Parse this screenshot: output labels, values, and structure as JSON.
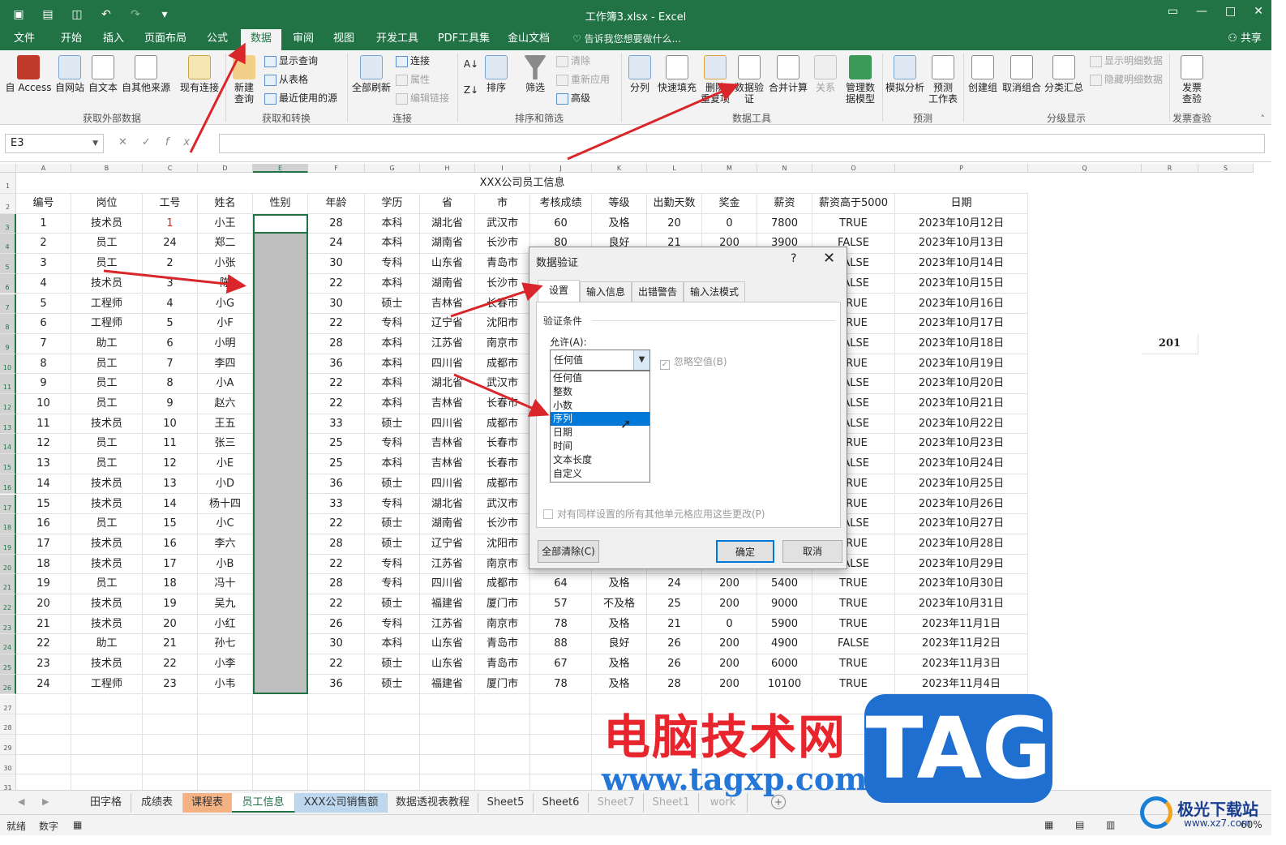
{
  "window": {
    "title": "工作簿3.xlsx - Excel",
    "share_label": "共享",
    "tell_me": "告诉我您想要做什么..."
  },
  "ribbon_tabs": [
    "文件",
    "开始",
    "插入",
    "页面布局",
    "公式",
    "数据",
    "审阅",
    "视图",
    "开发工具",
    "PDF工具集",
    "金山文档"
  ],
  "active_tab": "数据",
  "ribbon": {
    "get_external": {
      "label": "获取外部数据",
      "buttons": [
        "自 Access",
        "自网站",
        "自文本",
        "自其他来源",
        "现有连接"
      ]
    },
    "get_transform": {
      "label": "获取和转换",
      "new_query": "新建\n查询",
      "small": [
        "显示查询",
        "从表格",
        "最近使用的源"
      ]
    },
    "connections": {
      "label": "连接",
      "refresh_all": "全部刷新",
      "small": [
        "连接",
        "属性",
        "编辑链接"
      ]
    },
    "sort_filter": {
      "label": "排序和筛选",
      "sort": "排序",
      "filter": "筛选",
      "small": [
        "清除",
        "重新应用",
        "高级"
      ]
    },
    "data_tools": {
      "label": "数据工具",
      "buttons": [
        "分列",
        "快速填充",
        "删除\n重复项",
        "数据验\n证",
        "合并计算",
        "关系",
        "管理数\n据模型"
      ]
    },
    "forecast": {
      "label": "预测",
      "buttons": [
        "模拟分析",
        "预测\n工作表"
      ]
    },
    "outline": {
      "label": "分级显示",
      "buttons": [
        "创建组",
        "取消组合",
        "分类汇总"
      ],
      "small": [
        "显示明细数据",
        "隐藏明细数据"
      ]
    },
    "invoice": {
      "label": "发票查验",
      "button": "发票\n查验"
    }
  },
  "formula_bar": {
    "name_box": "E3",
    "formula": "",
    "fx": "fx"
  },
  "sheet": {
    "columns": [
      "A",
      "B",
      "C",
      "D",
      "E",
      "F",
      "G",
      "H",
      "I",
      "J",
      "K",
      "L",
      "M",
      "N",
      "O",
      "P",
      "Q",
      "R",
      "S"
    ],
    "title": "XXX公司员工信息",
    "headers": [
      "编号",
      "岗位",
      "工号",
      "姓名",
      "性别",
      "年龄",
      "学历",
      "省",
      "市",
      "考核成绩",
      "等级",
      "出勤天数",
      "奖金",
      "薪资",
      "薪资高于5000",
      "日期"
    ],
    "rows": [
      [
        "1",
        "技术员",
        "1",
        "小王",
        "",
        "28",
        "本科",
        "湖北省",
        "武汉市",
        "60",
        "及格",
        "20",
        "0",
        "7800",
        "TRUE",
        "2023年10月12日"
      ],
      [
        "2",
        "员工",
        "24",
        "郑二",
        "",
        "24",
        "本科",
        "湖南省",
        "长沙市",
        "80",
        "良好",
        "21",
        "200",
        "3900",
        "FALSE",
        "2023年10月13日"
      ],
      [
        "3",
        "员工",
        "2",
        "小张",
        "",
        "30",
        "专科",
        "山东省",
        "青岛市",
        "",
        "",
        "",
        "",
        "",
        "FALSE",
        "2023年10月14日"
      ],
      [
        "4",
        "技术员",
        "3",
        "陈",
        "",
        "22",
        "本科",
        "湖南省",
        "长沙市",
        "",
        "",
        "",
        "",
        "",
        "FALSE",
        "2023年10月15日"
      ],
      [
        "5",
        "工程师",
        "4",
        "小G",
        "",
        "30",
        "硕士",
        "吉林省",
        "长春市",
        "",
        "",
        "",
        "",
        "",
        "TRUE",
        "2023年10月16日"
      ],
      [
        "6",
        "工程师",
        "5",
        "小F",
        "",
        "22",
        "专科",
        "辽宁省",
        "沈阳市",
        "",
        "",
        "",
        "",
        "",
        "TRUE",
        "2023年10月17日"
      ],
      [
        "7",
        "助工",
        "6",
        "小明",
        "",
        "28",
        "本科",
        "江苏省",
        "南京市",
        "",
        "",
        "",
        "",
        "",
        "FALSE",
        "2023年10月18日"
      ],
      [
        "8",
        "员工",
        "7",
        "李四",
        "",
        "36",
        "本科",
        "四川省",
        "成都市",
        "",
        "",
        "",
        "",
        "",
        "TRUE",
        "2023年10月19日"
      ],
      [
        "9",
        "员工",
        "8",
        "小A",
        "",
        "22",
        "本科",
        "湖北省",
        "武汉市",
        "",
        "",
        "",
        "",
        "",
        "FALSE",
        "2023年10月20日"
      ],
      [
        "10",
        "员工",
        "9",
        "赵六",
        "",
        "22",
        "本科",
        "吉林省",
        "长春市",
        "",
        "",
        "",
        "",
        "",
        "FALSE",
        "2023年10月21日"
      ],
      [
        "11",
        "技术员",
        "10",
        "王五",
        "",
        "33",
        "硕士",
        "四川省",
        "成都市",
        "",
        "",
        "",
        "",
        "",
        "FALSE",
        "2023年10月22日"
      ],
      [
        "12",
        "员工",
        "11",
        "张三",
        "",
        "25",
        "专科",
        "吉林省",
        "长春市",
        "",
        "",
        "",
        "",
        "",
        "TRUE",
        "2023年10月23日"
      ],
      [
        "13",
        "员工",
        "12",
        "小E",
        "",
        "25",
        "本科",
        "吉林省",
        "长春市",
        "",
        "",
        "",
        "",
        "",
        "FALSE",
        "2023年10月24日"
      ],
      [
        "14",
        "技术员",
        "13",
        "小D",
        "",
        "36",
        "硕士",
        "四川省",
        "成都市",
        "",
        "",
        "",
        "",
        "",
        "TRUE",
        "2023年10月25日"
      ],
      [
        "15",
        "技术员",
        "14",
        "杨十四",
        "",
        "33",
        "专科",
        "湖北省",
        "武汉市",
        "",
        "",
        "",
        "",
        "",
        "TRUE",
        "2023年10月26日"
      ],
      [
        "16",
        "员工",
        "15",
        "小C",
        "",
        "22",
        "硕士",
        "湖南省",
        "长沙市",
        "",
        "",
        "",
        "",
        "",
        "FALSE",
        "2023年10月27日"
      ],
      [
        "17",
        "技术员",
        "16",
        "李六",
        "",
        "28",
        "硕士",
        "辽宁省",
        "沈阳市",
        "",
        "",
        "",
        "",
        "",
        "TRUE",
        "2023年10月28日"
      ],
      [
        "18",
        "技术员",
        "17",
        "小B",
        "",
        "22",
        "专科",
        "江苏省",
        "南京市",
        "",
        "",
        "",
        "",
        "",
        "FALSE",
        "2023年10月29日"
      ],
      [
        "19",
        "员工",
        "18",
        "冯十",
        "",
        "28",
        "专科",
        "四川省",
        "成都市",
        "64",
        "及格",
        "24",
        "200",
        "5400",
        "TRUE",
        "2023年10月30日"
      ],
      [
        "20",
        "技术员",
        "19",
        "吴九",
        "",
        "22",
        "硕士",
        "福建省",
        "厦门市",
        "57",
        "不及格",
        "25",
        "200",
        "9000",
        "TRUE",
        "2023年10月31日"
      ],
      [
        "21",
        "技术员",
        "20",
        "小红",
        "",
        "26",
        "专科",
        "江苏省",
        "南京市",
        "78",
        "及格",
        "21",
        "0",
        "5900",
        "TRUE",
        "2023年11月1日"
      ],
      [
        "22",
        "助工",
        "21",
        "孙七",
        "",
        "30",
        "本科",
        "山东省",
        "青岛市",
        "88",
        "良好",
        "26",
        "200",
        "4900",
        "FALSE",
        "2023年11月2日"
      ],
      [
        "23",
        "技术员",
        "22",
        "小李",
        "",
        "22",
        "硕士",
        "山东省",
        "青岛市",
        "67",
        "及格",
        "26",
        "200",
        "6000",
        "TRUE",
        "2023年11月3日"
      ],
      [
        "24",
        "工程师",
        "23",
        "小韦",
        "",
        "36",
        "硕士",
        "福建省",
        "厦门市",
        "78",
        "及格",
        "28",
        "200",
        "10100",
        "TRUE",
        "2023年11月4日"
      ]
    ],
    "r9_value": "201",
    "row_numbers": [
      "1",
      "2",
      "3",
      "4",
      "5",
      "6",
      "7",
      "8",
      "9",
      "10",
      "11",
      "12",
      "13",
      "14",
      "15",
      "16",
      "17",
      "18",
      "19",
      "20",
      "21",
      "22",
      "23",
      "24",
      "25",
      "26",
      "27",
      "28",
      "29",
      "30",
      "31"
    ]
  },
  "sheet_tabs": [
    "田字格",
    "成绩表",
    "课程表",
    "员工信息",
    "XXX公司销售额",
    "数据透视表教程",
    "Sheet5",
    "Sheet6",
    "Sheet7",
    "Sheet1",
    "work"
  ],
  "active_sheet": "员工信息",
  "status_bar": {
    "ready": "就绪",
    "mode": "数字",
    "zoom": "60%"
  },
  "dialog": {
    "title": "数据验证",
    "help": "?",
    "tabs": [
      "设置",
      "输入信息",
      "出错警告",
      "输入法模式"
    ],
    "group_label": "验证条件",
    "allow_label": "允许(A):",
    "allow_value": "任何值",
    "ignore_blank": "忽略空值(B)",
    "options": [
      "任何值",
      "整数",
      "小数",
      "序列",
      "日期",
      "时间",
      "文本长度",
      "自定义"
    ],
    "highlighted_option": "序列",
    "apply_all": "对有同样设置的所有其他单元格应用这些更改(P)",
    "clear_all": "全部清除(C)",
    "ok": "确定",
    "cancel": "取消"
  },
  "watermark": {
    "cn": "电脑技术网",
    "url": "www.tagxp.com",
    "tag": "TAG",
    "logo_cn": "极光下载站",
    "logo_url": "www.xz7.com"
  },
  "colors": {
    "excel_green": "#217346",
    "arrow_red": "#d9262a",
    "selected_grey": "#bfbfbf"
  }
}
